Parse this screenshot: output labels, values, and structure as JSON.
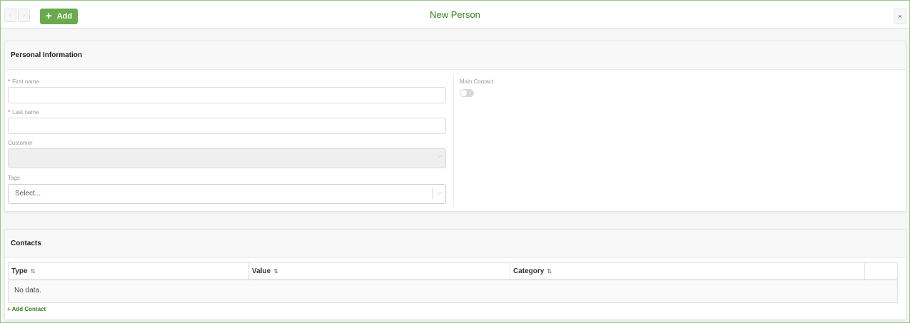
{
  "header": {
    "title": "New Person",
    "add_label": "Add",
    "add_icon": "+",
    "prev_icon": "‹",
    "next_icon": "›",
    "close_icon": "×"
  },
  "personal": {
    "section_title": "Personal Information",
    "first_name": {
      "label": "First name",
      "value": ""
    },
    "last_name": {
      "label": "Last name",
      "value": ""
    },
    "customer": {
      "label": "Customer",
      "value": ""
    },
    "tags": {
      "label": "Tags",
      "placeholder": "Select..."
    },
    "main_contact": {
      "label": "Main Contact",
      "checked": false
    },
    "required_mark": "*"
  },
  "contacts": {
    "section_title": "Contacts",
    "columns": [
      "Type",
      "Value",
      "Category"
    ],
    "sort_icon": "⇅",
    "empty_text": "No data.",
    "add_label": "+ Add Contact"
  },
  "colors": {
    "accent": "#6aaa4f",
    "title_green": "#3a7d21",
    "required": "#d9534f"
  }
}
